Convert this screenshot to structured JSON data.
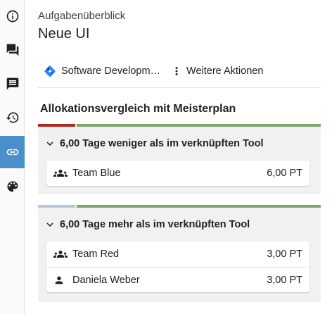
{
  "sidebar": {
    "items": [
      {
        "name": "info-icon",
        "active": false
      },
      {
        "name": "chat-icon",
        "active": false
      },
      {
        "name": "comment-icon",
        "active": false
      },
      {
        "name": "history-icon",
        "active": false
      },
      {
        "name": "link-icon",
        "active": true
      },
      {
        "name": "palette-icon",
        "active": false
      }
    ],
    "active_color": "#4a8fcb"
  },
  "header": {
    "subtitle": "Aufgabenüberblick",
    "title": "Neue UI"
  },
  "toolbar": {
    "project_label": "Software Developm…",
    "project_icon": "jira-icon",
    "more_label": "Weitere Aktionen",
    "more_icon": "more-vertical-icon"
  },
  "section": {
    "title": "Allokationsvergleich mit Meisterplan"
  },
  "groups": [
    {
      "label": "6,00 Tage weniger als im verknüpften Tool",
      "bar_colors": [
        "#b3261e",
        "#7fa56a"
      ],
      "rows": [
        {
          "icon": "group-icon",
          "name": "Team Blue",
          "value": "6,00 PT"
        }
      ]
    },
    {
      "label": "6,00 Tage mehr als im verknüpften Tool",
      "bar_colors": [
        "#b7c8dc",
        "#7fa56a"
      ],
      "rows": [
        {
          "icon": "group-icon",
          "name": "Team Red",
          "value": "3,00 PT"
        },
        {
          "icon": "person-icon",
          "name": "Daniela Weber",
          "value": "3,00 PT"
        }
      ]
    }
  ]
}
